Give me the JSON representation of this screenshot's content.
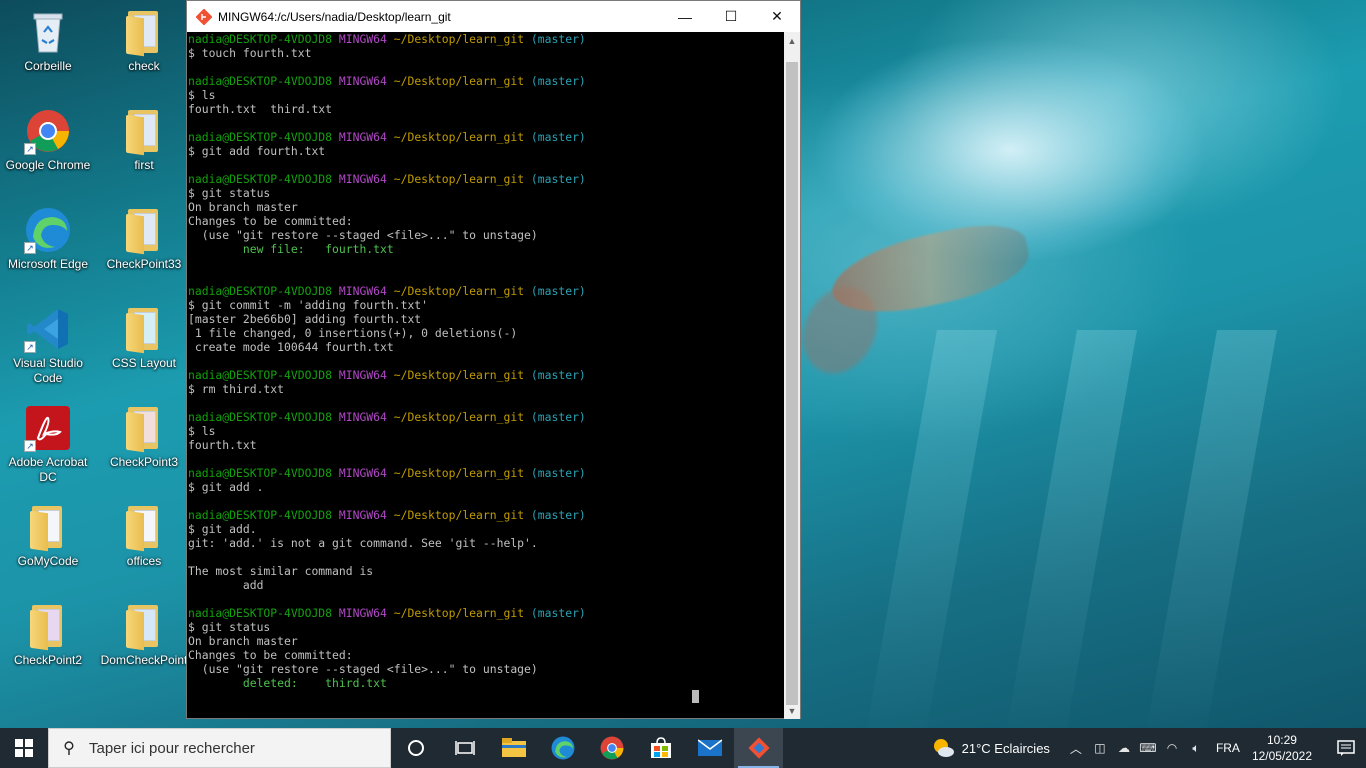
{
  "desktop": {
    "icons": [
      {
        "label": "Corbeille"
      },
      {
        "label": "check"
      },
      {
        "label": "Google Chrome"
      },
      {
        "label": "first"
      },
      {
        "label": "Microsoft Edge"
      },
      {
        "label": "CheckPoint33"
      },
      {
        "label": "Visual Studio Code"
      },
      {
        "label": "CSS Layout"
      },
      {
        "label": "Adobe Acrobat DC"
      },
      {
        "label": "CheckPoint3"
      },
      {
        "label": "GoMyCode"
      },
      {
        "label": "offices"
      },
      {
        "label": "CheckPoint2"
      },
      {
        "label": "DomCheckPoint"
      }
    ]
  },
  "window": {
    "title": "MINGW64:/c/Users/nadia/Desktop/learn_git",
    "minimize": "—",
    "maximize": "☐",
    "close": "✕"
  },
  "prompt": {
    "user": "nadia@DESKTOP-4VDOJD8",
    "shell": "MINGW64",
    "path": "~/Desktop/learn_git",
    "branch": "(master)"
  },
  "terminal": [
    {
      "t": "prompt"
    },
    {
      "t": "text",
      "text": "$ touch fourth.txt"
    },
    {
      "t": "text",
      "text": ""
    },
    {
      "t": "prompt"
    },
    {
      "t": "text",
      "text": "$ ls"
    },
    {
      "t": "text",
      "text": "fourth.txt  third.txt"
    },
    {
      "t": "text",
      "text": ""
    },
    {
      "t": "prompt"
    },
    {
      "t": "text",
      "text": "$ git add fourth.txt"
    },
    {
      "t": "text",
      "text": ""
    },
    {
      "t": "prompt"
    },
    {
      "t": "text",
      "text": "$ git status"
    },
    {
      "t": "text",
      "text": "On branch master"
    },
    {
      "t": "text",
      "text": "Changes to be committed:"
    },
    {
      "t": "text",
      "text": "  (use \"git restore --staged <file>...\" to unstage)"
    },
    {
      "t": "green",
      "text": "        new file:   fourth.txt"
    },
    {
      "t": "text",
      "text": ""
    },
    {
      "t": "text",
      "text": ""
    },
    {
      "t": "prompt"
    },
    {
      "t": "text",
      "text": "$ git commit -m 'adding fourth.txt'"
    },
    {
      "t": "text",
      "text": "[master 2be66b0] adding fourth.txt"
    },
    {
      "t": "text",
      "text": " 1 file changed, 0 insertions(+), 0 deletions(-)"
    },
    {
      "t": "text",
      "text": " create mode 100644 fourth.txt"
    },
    {
      "t": "text",
      "text": ""
    },
    {
      "t": "prompt"
    },
    {
      "t": "text",
      "text": "$ rm third.txt"
    },
    {
      "t": "text",
      "text": ""
    },
    {
      "t": "prompt"
    },
    {
      "t": "text",
      "text": "$ ls"
    },
    {
      "t": "text",
      "text": "fourth.txt"
    },
    {
      "t": "text",
      "text": ""
    },
    {
      "t": "prompt"
    },
    {
      "t": "text",
      "text": "$ git add ."
    },
    {
      "t": "text",
      "text": ""
    },
    {
      "t": "prompt"
    },
    {
      "t": "text",
      "text": "$ git add."
    },
    {
      "t": "text",
      "text": "git: 'add.' is not a git command. See 'git --help'."
    },
    {
      "t": "text",
      "text": ""
    },
    {
      "t": "text",
      "text": "The most similar command is"
    },
    {
      "t": "text",
      "text": "        add"
    },
    {
      "t": "text",
      "text": ""
    },
    {
      "t": "prompt"
    },
    {
      "t": "text",
      "text": "$ git status"
    },
    {
      "t": "text",
      "text": "On branch master"
    },
    {
      "t": "text",
      "text": "Changes to be committed:"
    },
    {
      "t": "text",
      "text": "  (use \"git restore --staged <file>...\" to unstage)"
    },
    {
      "t": "green",
      "text": "        deleted:    third.txt"
    }
  ],
  "taskbar": {
    "search_placeholder": "Taper ici pour rechercher",
    "apps": [
      "cortana-icon",
      "task-view-icon",
      "file-explorer-icon",
      "edge-icon",
      "chrome-icon",
      "store-icon",
      "mail-icon",
      "git-bash-icon"
    ],
    "weather": "21°C  Eclaircies",
    "language": "FRA",
    "time": "10:29",
    "date": "12/05/2022"
  },
  "colors": {
    "prompt_user": "#13a10e",
    "prompt_shell": "#b148c6",
    "prompt_path": "#c19c00",
    "prompt_branch": "#2aa1b3",
    "taskbar": "#1f2a33"
  }
}
